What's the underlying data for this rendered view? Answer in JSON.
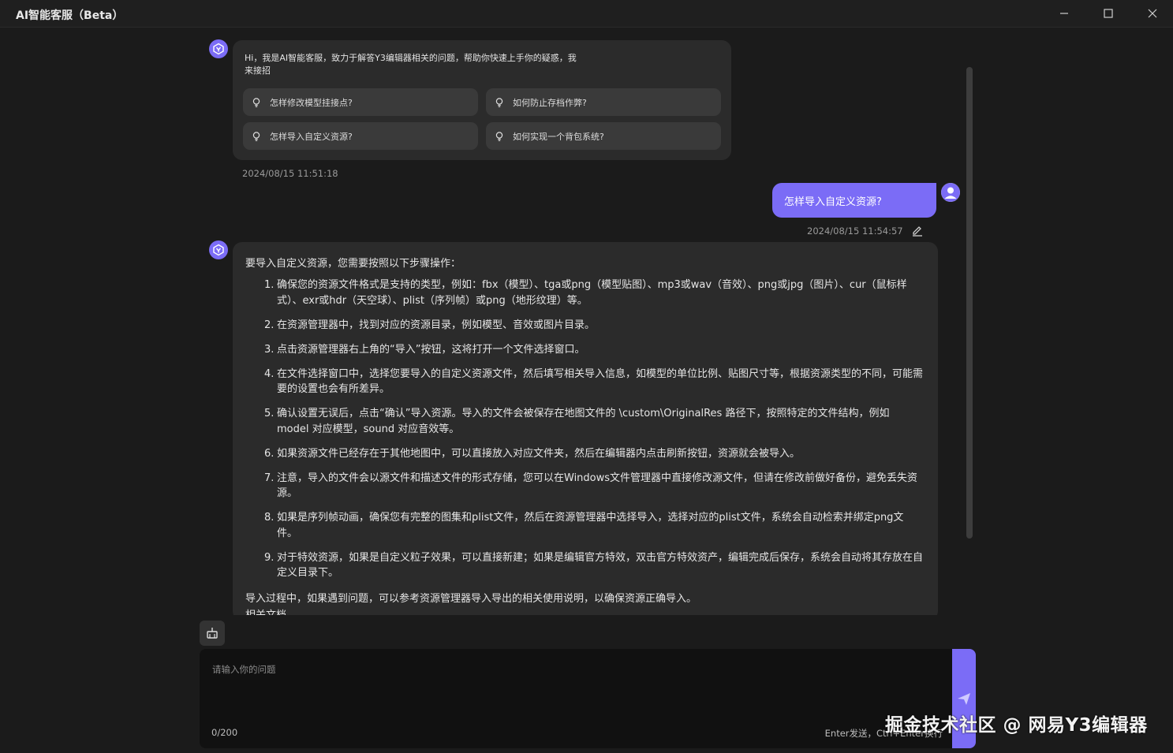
{
  "window": {
    "title": "AI智能客服（Beta）"
  },
  "welcome": {
    "greeting": "Hi，我是AI智能客服，致力于解答Y3编辑器相关的问题，帮助你快速上手你的疑惑，我来接招",
    "suggestions": [
      "怎样修改模型挂接点?",
      "如何防止存档作弊?",
      "怎样导入自定义资源?",
      "如何实现一个背包系统?"
    ],
    "timestamp": "2024/08/15 11:51:18"
  },
  "user_message": {
    "text": "怎样导入自定义资源?",
    "timestamp": "2024/08/15 11:54:57"
  },
  "answer": {
    "intro": "要导入自定义资源，您需要按照以下步骤操作：",
    "steps": [
      {
        "num": "1.",
        "text": "确保您的资源文件格式是支持的类型，例如：fbx（模型）、tga或png（模型贴图）、mp3或wav（音效）、png或jpg（图片）、cur（鼠标样式）、exr或hdr（天空球）、plist（序列帧）或png（地形纹理）等。"
      },
      {
        "num": "2.",
        "text": "在资源管理器中，找到对应的资源目录，例如模型、音效或图片目录。"
      },
      {
        "num": "3.",
        "text": "点击资源管理器右上角的“导入”按钮，这将打开一个文件选择窗口。"
      },
      {
        "num": "4.",
        "text": "在文件选择窗口中，选择您要导入的自定义资源文件，然后填写相关导入信息，如模型的单位比例、贴图尺寸等，根据资源类型的不同，可能需要的设置也会有所差异。"
      },
      {
        "num": "5.",
        "text": "确认设置无误后，点击“确认”导入资源。导入的文件会被保存在地图文件的 \\custom\\OriginalRes 路径下，按照特定的文件结构，例如 model 对应模型，sound 对应音效等。"
      },
      {
        "num": "6.",
        "text": "如果资源文件已经存在于其他地图中，可以直接放入对应文件夹，然后在编辑器内点击刷新按钮，资源就会被导入。"
      },
      {
        "num": "7.",
        "text": "注意，导入的文件会以源文件和描述文件的形式存储，您可以在Windows文件管理器中直接修改源文件，但请在修改前做好备份，避免丢失资源。"
      },
      {
        "num": "8.",
        "text": "如果是序列帧动画，确保您有完整的图集和plist文件，然后在资源管理器中选择导入，选择对应的plist文件，系统会自动检索并绑定png文件。"
      },
      {
        "num": "9.",
        "text": "对于特效资源，如果是自定义粒子效果，可以直接新建；如果是编辑官方特效，双击官方特效资产，编辑完成后保存，系统会自动将其存放在自定义目录下。"
      }
    ],
    "outro": "导入过程中，如果遇到问题，可以参考资源管理器导入导出的相关使用说明，以确保资源正确导入。",
    "docs_label": "相关文档"
  },
  "input": {
    "placeholder": "请输入你的问题",
    "counter": "0/200",
    "hint": "Enter发送，Ctrl+Enter换行"
  },
  "watermark": "掘金技术社区 @ 网易Y3编辑器",
  "colors": {
    "accent": "#7b6cf6",
    "background": "#1b1b1b",
    "bubble": "#2b2b2b"
  }
}
